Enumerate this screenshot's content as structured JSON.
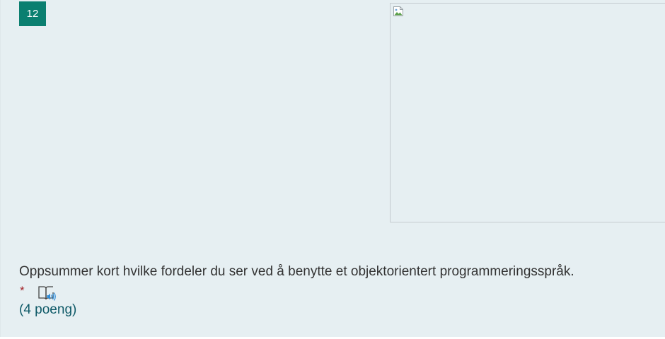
{
  "question": {
    "number": "12",
    "text": "Oppsummer kort hvilke fordeler du ser ved å benytte et objektorientert programmeringsspråk.",
    "required_marker": "*",
    "points": "(4 poeng)",
    "image_icon": "broken-image-icon",
    "reader_icon": "immersive-reader-icon"
  },
  "colors": {
    "background": "#e6eff2",
    "number_badge": "#0b7f70",
    "required": "#a4262c",
    "points_text": "#0f5a68",
    "reader_accent": "#2e8bd6"
  }
}
